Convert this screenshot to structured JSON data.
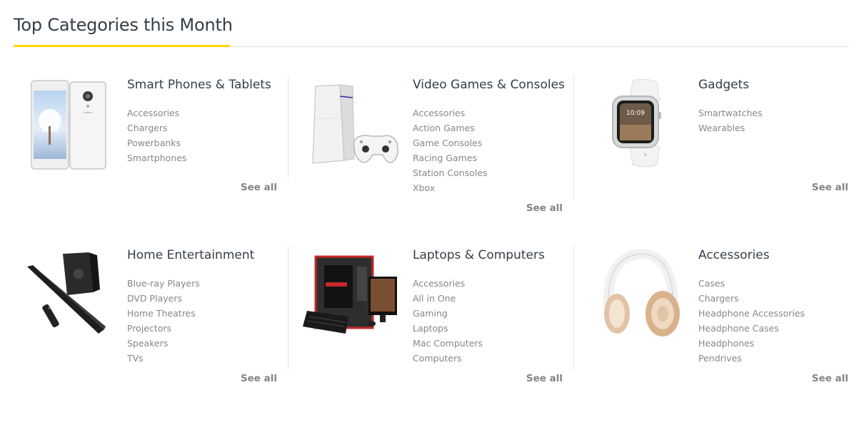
{
  "section": {
    "title": "Top Categories this Month",
    "accent_color": "#fed700"
  },
  "categories": [
    {
      "title": "Smart Phones & Tablets",
      "image_icon": "smartphone-image",
      "items": [
        "Accessories",
        "Chargers",
        "Powerbanks",
        "Smartphones"
      ],
      "see_all": "See all"
    },
    {
      "title": "Video Games & Consoles",
      "image_icon": "game-console-image",
      "items": [
        "Accessories",
        "Action Games",
        "Game Consoles",
        "Racing Games",
        "Station Consoles",
        "Xbox"
      ],
      "see_all": "See all"
    },
    {
      "title": "Gadgets",
      "image_icon": "smartwatch-image",
      "items": [
        "Smartwatches",
        "Wearables"
      ],
      "see_all": "See all"
    },
    {
      "title": "Home Entertainment",
      "image_icon": "soundbar-image",
      "items": [
        "Blue-ray Players",
        "DVD Players",
        "Home Theatres",
        "Projectors",
        "Speakers",
        "TVs"
      ],
      "see_all": "See all"
    },
    {
      "title": "Laptops & Computers",
      "image_icon": "desktop-computer-image",
      "items": [
        "Accessories",
        "All in One",
        "Gaming",
        "Laptops",
        "Mac Computers",
        "Computers"
      ],
      "see_all": "See all"
    },
    {
      "title": "Accessories",
      "image_icon": "headphones-image",
      "items": [
        "Cases",
        "Chargers",
        "Headphone Accessories",
        "Headphone Cases",
        "Headphones",
        "Pendrives"
      ],
      "see_all": "See all"
    }
  ]
}
